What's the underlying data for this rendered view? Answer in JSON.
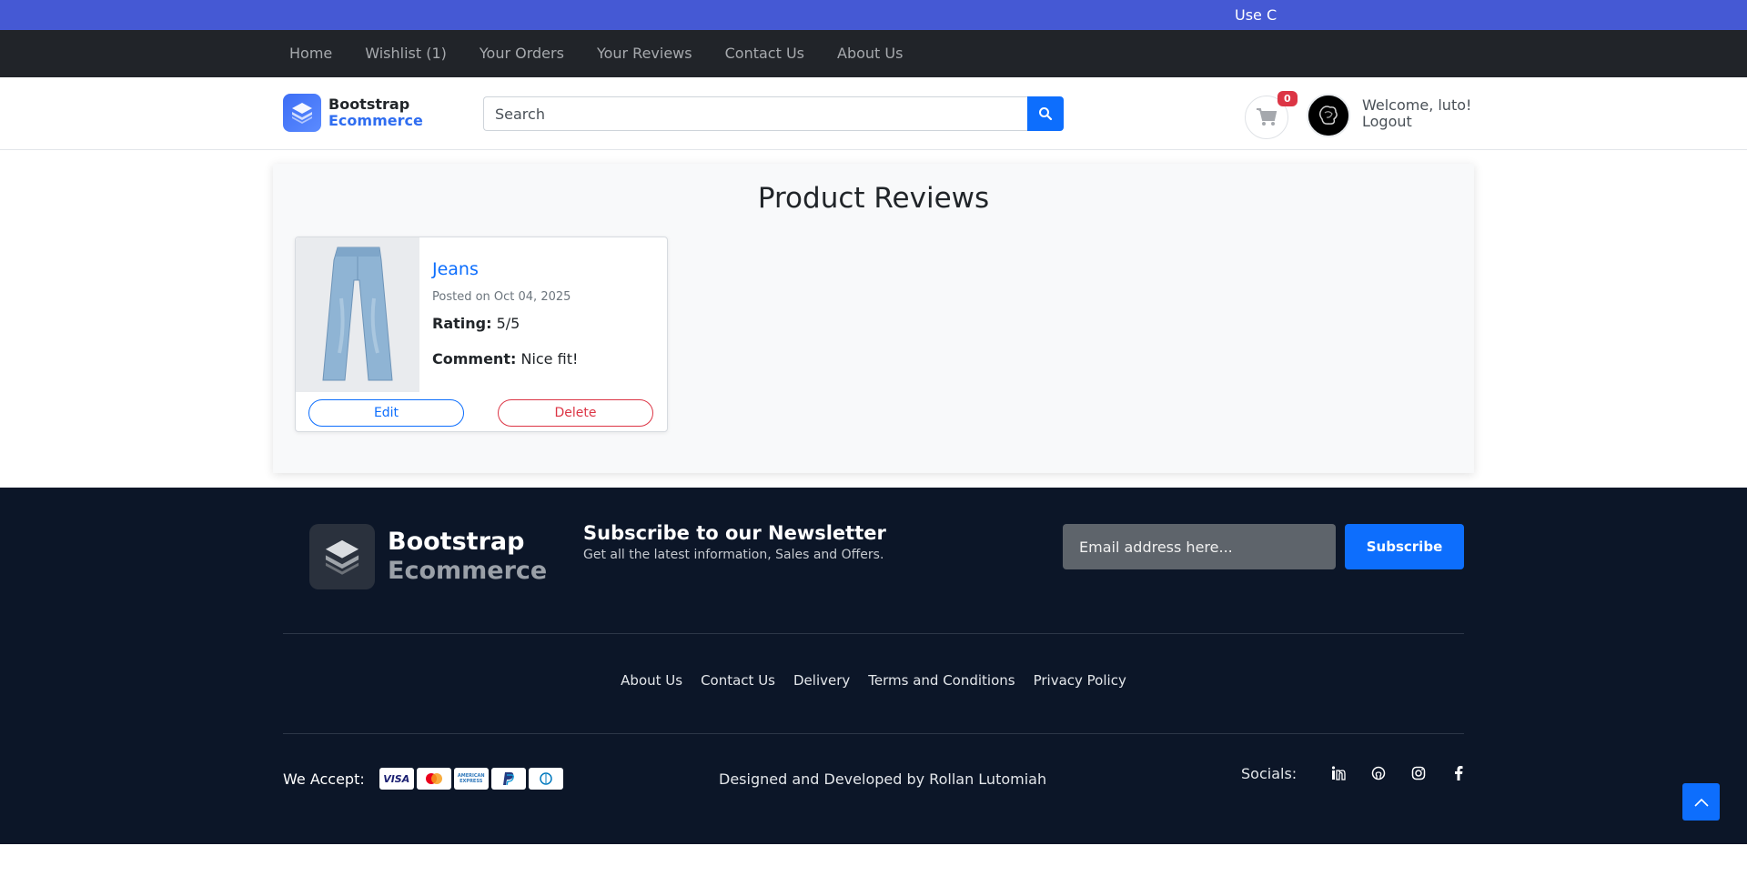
{
  "announcement": "Use C",
  "topnav": {
    "items": [
      "Home",
      "Wishlist (1)",
      "Your Orders",
      "Your Reviews",
      "Contact Us",
      "About Us"
    ]
  },
  "header": {
    "brand_line1": "Bootstrap",
    "brand_line2": "Ecommerce",
    "search_placeholder": "Search",
    "cart_count": "0",
    "welcome": "Welcome, luto!",
    "logout": "Logout"
  },
  "main": {
    "title": "Product Reviews",
    "reviews": [
      {
        "product": "Jeans",
        "posted": "Posted on Oct 04, 2025",
        "rating_label": "Rating:",
        "rating_value": "5/5",
        "comment_label": "Comment:",
        "comment_value": "Nice fit!",
        "edit_label": "Edit",
        "delete_label": "Delete"
      }
    ]
  },
  "footer": {
    "brand_line1": "Bootstrap",
    "brand_line2": "Ecommerce",
    "newsletter_title": "Subscribe to our Newsletter",
    "newsletter_text": "Get all the latest information, Sales and Offers.",
    "email_placeholder": "Email address here...",
    "subscribe_label": "Subscribe",
    "links": [
      "About Us",
      "Contact Us",
      "Delivery",
      "Terms and Conditions",
      "Privacy Policy"
    ],
    "we_accept": "We Accept:",
    "payment_cards": [
      "VISA",
      "",
      "AMERICAN EXPRESS",
      "",
      ""
    ],
    "credit": "Designed and Developed by  Rollan Lutomiah",
    "socials_label": "Socials:",
    "social_icons": [
      "linkedin-icon",
      "github-icon",
      "instagram-icon",
      "facebook-icon"
    ]
  },
  "colors": {
    "announcement_bg": "#4559d4",
    "nav_bg": "#212429",
    "primary": "#0d6efd",
    "danger": "#dc3545",
    "footer_bg": "#0c1628"
  }
}
